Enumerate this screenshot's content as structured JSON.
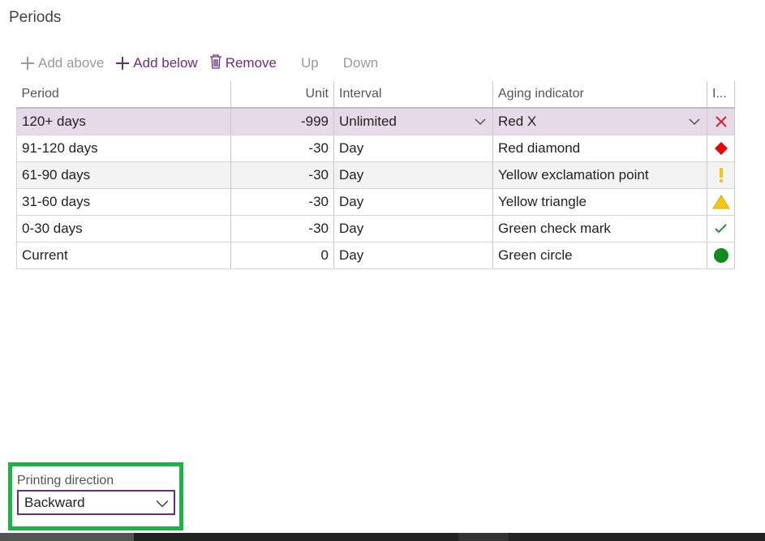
{
  "section": {
    "title": "Periods"
  },
  "toolbar": {
    "add_above": "Add above",
    "add_below": "Add below",
    "remove": "Remove",
    "up": "Up",
    "down": "Down"
  },
  "grid": {
    "headers": {
      "period": "Period",
      "unit": "Unit",
      "interval": "Interval",
      "aging": "Aging indicator",
      "icon": "I..."
    },
    "rows": [
      {
        "period": "120+ days",
        "unit": "-999",
        "interval": "Unlimited",
        "aging": "Red X",
        "icon": "red-x-icon"
      },
      {
        "period": "91-120 days",
        "unit": "-30",
        "interval": "Day",
        "aging": "Red diamond",
        "icon": "red-diamond-icon"
      },
      {
        "period": "61-90 days",
        "unit": "-30",
        "interval": "Day",
        "aging": "Yellow exclamation point",
        "icon": "yellow-exclamation-icon"
      },
      {
        "period": "31-60 days",
        "unit": "-30",
        "interval": "Day",
        "aging": "Yellow triangle",
        "icon": "yellow-triangle-icon"
      },
      {
        "period": "0-30 days",
        "unit": "-30",
        "interval": "Day",
        "aging": "Green check mark",
        "icon": "green-check-icon"
      },
      {
        "period": "Current",
        "unit": "0",
        "interval": "Day",
        "aging": "Green circle",
        "icon": "green-circle-icon"
      }
    ]
  },
  "printing": {
    "label": "Printing direction",
    "value": "Backward"
  },
  "colors": {
    "accent": "#6b2d7f",
    "highlight": "#1fb04b",
    "selected_row": "#e6d9e8"
  }
}
